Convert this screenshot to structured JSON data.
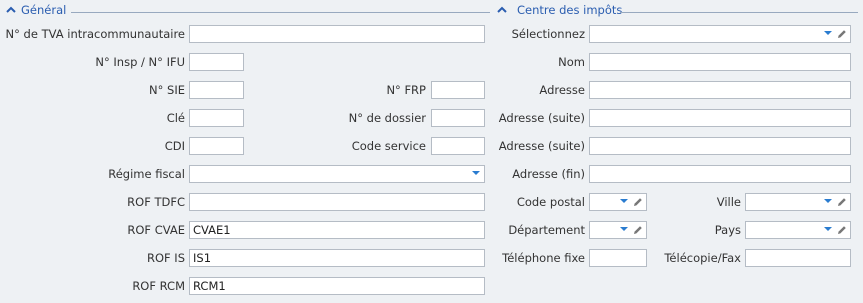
{
  "general": {
    "section_title": "Général",
    "tva_label": "N° de TVA intracommunautaire",
    "tva_value": "",
    "insp_ifu_label": "N° Insp / N° IFU",
    "insp_ifu_value": "",
    "sie_label": "N° SIE",
    "sie_value": "",
    "frp_label": "N° FRP",
    "frp_value": "",
    "cle_label": "Clé",
    "cle_value": "",
    "dossier_label": "N° de dossier",
    "dossier_value": "",
    "cdi_label": "CDI",
    "cdi_value": "",
    "code_service_label": "Code service",
    "code_service_value": "",
    "regime_fiscal_label": "Régime fiscal",
    "regime_fiscal_value": "",
    "rof_tdfc_label": "ROF TDFC",
    "rof_tdfc_value": "",
    "rof_cvae_label": "ROF CVAE",
    "rof_cvae_value": "CVAE1",
    "rof_is_label": "ROF IS",
    "rof_is_value": "IS1",
    "rof_rcm_label": "ROF RCM",
    "rof_rcm_value": "RCM1"
  },
  "centre": {
    "section_title": "Centre des impôts",
    "selectionnez_label": "Sélectionnez",
    "selectionnez_value": "",
    "nom_label": "Nom",
    "nom_value": "",
    "adresse_label": "Adresse",
    "adresse_value": "",
    "adresse_suite1_label": "Adresse (suite)",
    "adresse_suite1_value": "",
    "adresse_suite2_label": "Adresse (suite)",
    "adresse_suite2_value": "",
    "adresse_fin_label": "Adresse (fin)",
    "adresse_fin_value": "",
    "code_postal_label": "Code postal",
    "code_postal_value": "",
    "ville_label": "Ville",
    "ville_value": "",
    "departement_label": "Département",
    "departement_value": "",
    "pays_label": "Pays",
    "pays_value": "",
    "telephone_label": "Téléphone fixe",
    "telephone_value": "",
    "telecopie_label": "Télécopie/Fax",
    "telecopie_value": ""
  },
  "icons": {
    "collapse": "chevron-up-icon",
    "dropdown": "dropdown-arrow-icon",
    "edit": "pencil-icon",
    "accent_color": "#2a5db0",
    "arrow_color": "#2a7cd0"
  }
}
